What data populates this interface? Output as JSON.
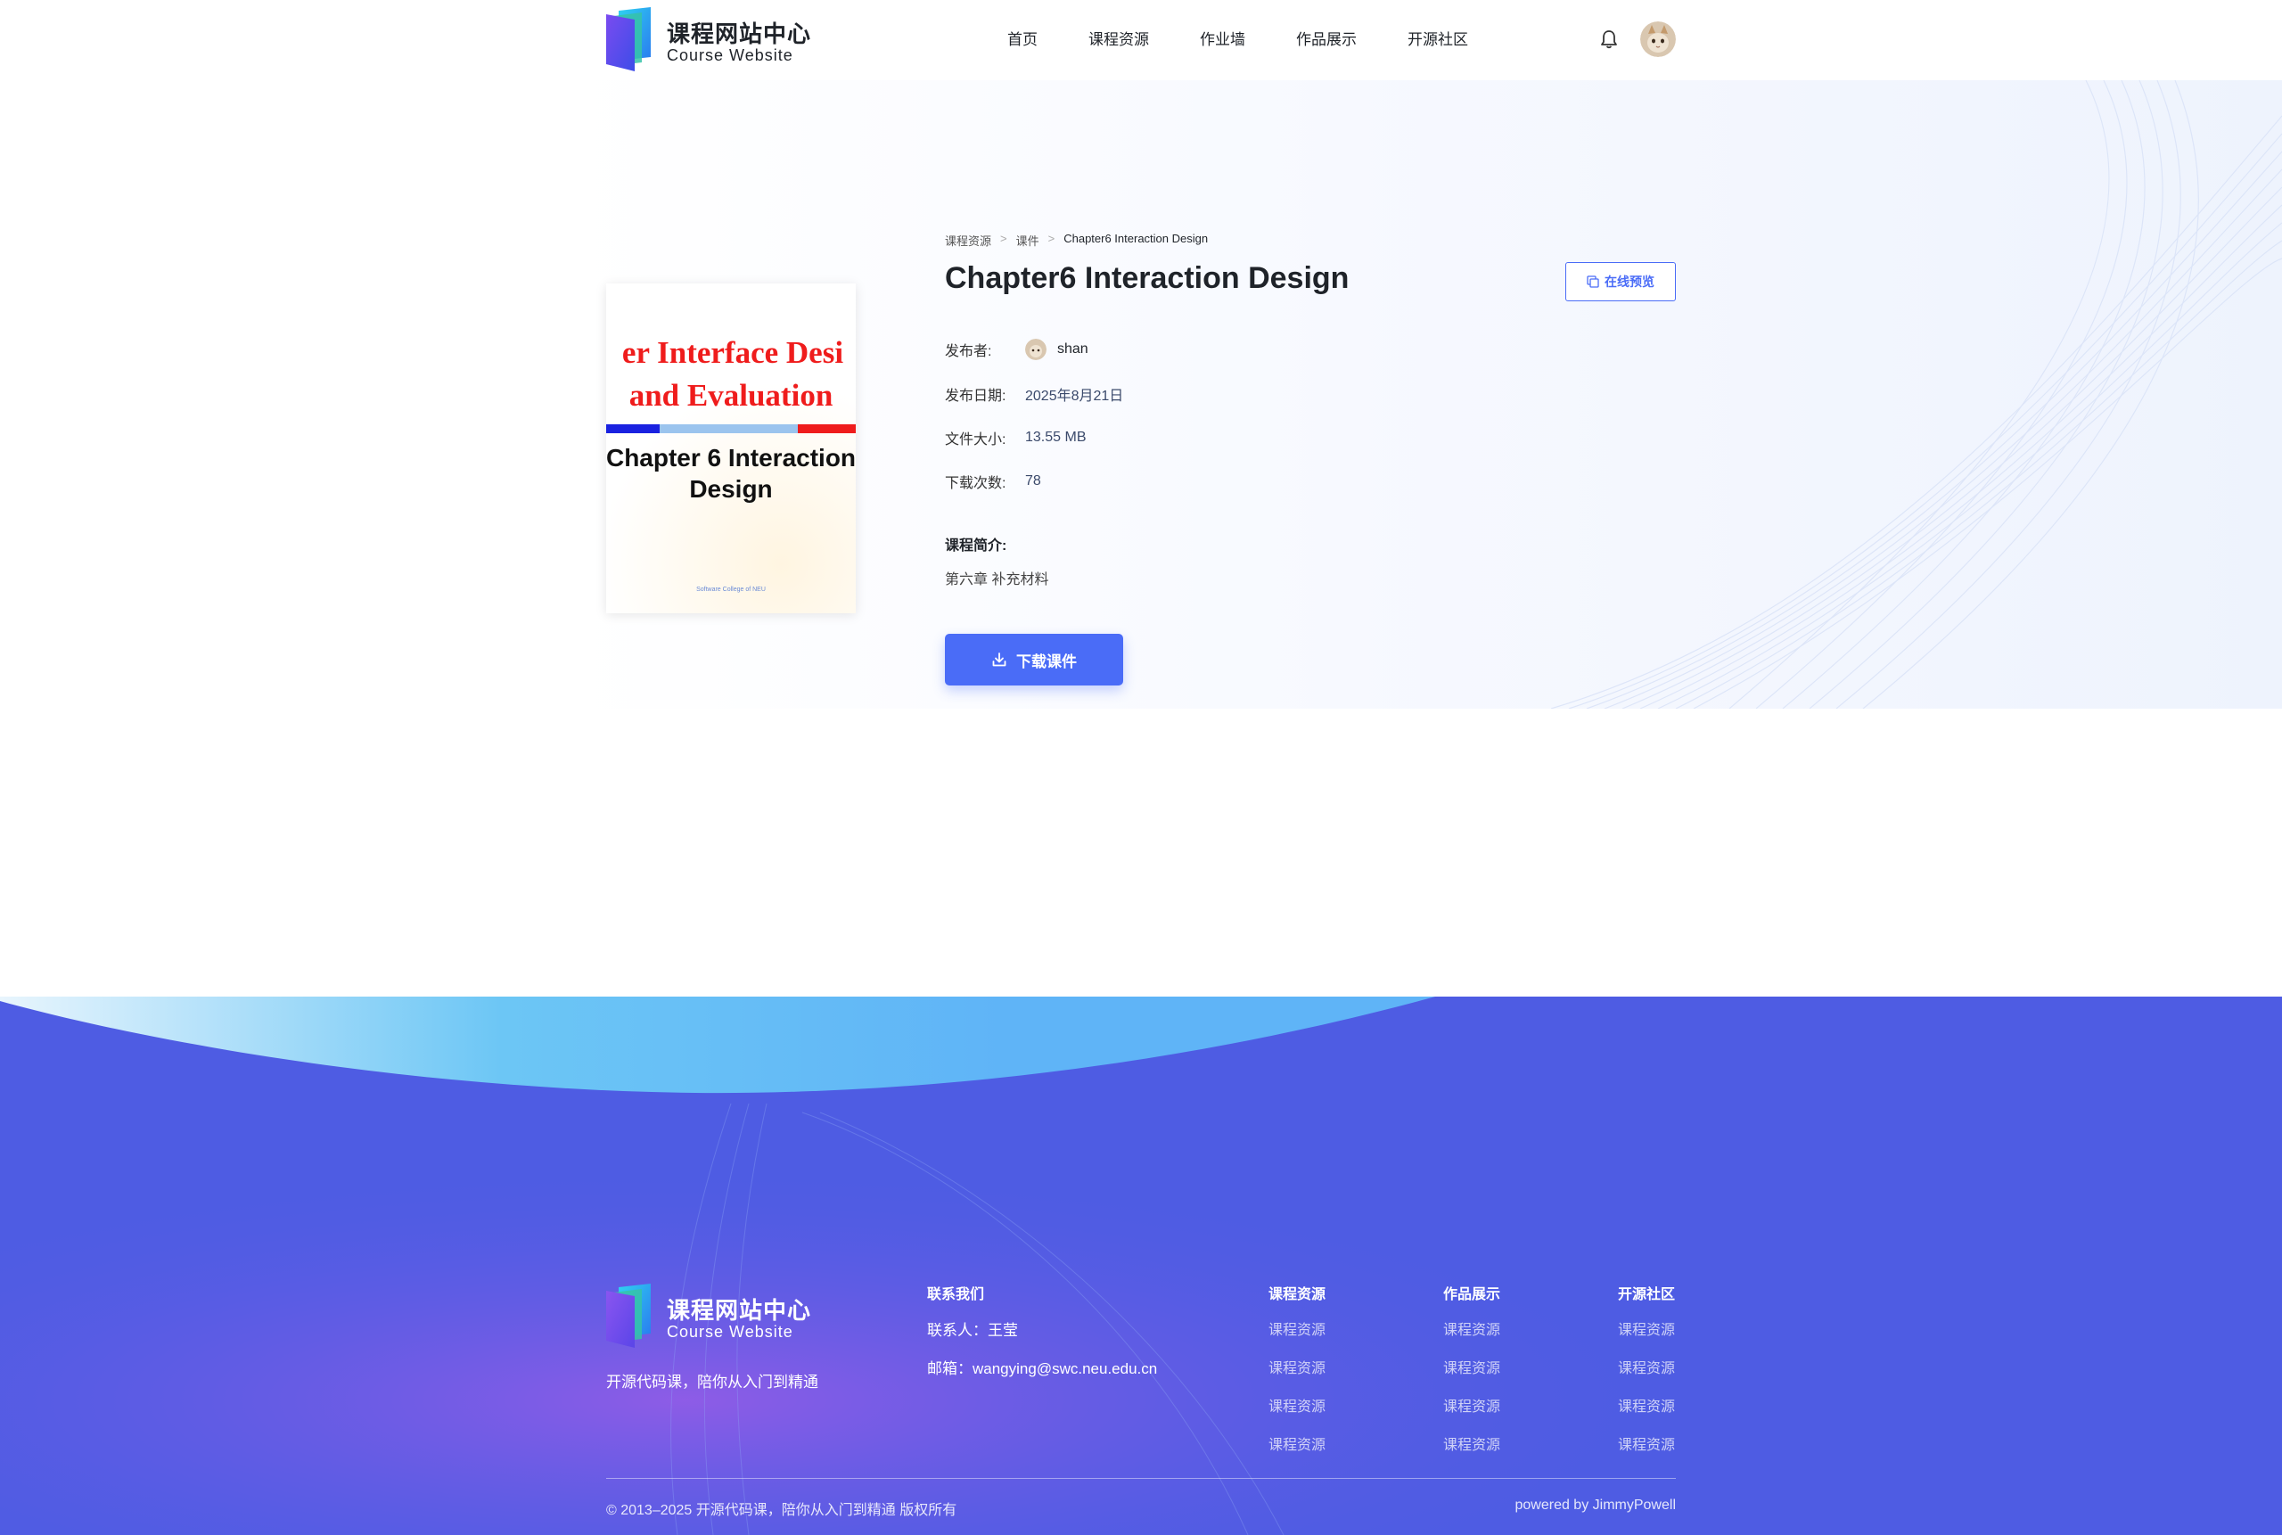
{
  "header": {
    "logo_title": "课程网站中心",
    "logo_subtitle": "Course Website",
    "nav": [
      "首页",
      "课程资源",
      "作业墙",
      "作品展示",
      "开源社区"
    ]
  },
  "detail": {
    "breadcrumb": [
      "课程资源",
      "课件",
      "Chapter6 Interaction Design"
    ],
    "title": "Chapter6 Interaction Design",
    "preview_label": "在线预览",
    "publisher_label": "发布者:",
    "publisher_name": "shan",
    "date_label": "发布日期:",
    "date_value": "2025年8月21日",
    "size_label": "文件大小:",
    "size_value": "13.55 MB",
    "downloads_label": "下载次数:",
    "downloads_value": "78",
    "intro_label": "课程简介:",
    "intro_text": "第六章 补充材料",
    "download_label": "下载课件"
  },
  "cover": {
    "line1": "er Interface Desi",
    "line2": "and Evaluation",
    "line3": "Chapter 6  Interaction",
    "line4": "Design",
    "footer": "Software College of NEU"
  },
  "footer": {
    "logo_title": "课程网站中心",
    "logo_subtitle": "Course Website",
    "slogan": "开源代码课，陪你从入门到精通",
    "contact_heading": "联系我们",
    "contact_person": "联系人：王莹",
    "contact_email": "邮箱：wangying@swc.neu.edu.cn",
    "col1_heading": "课程资源",
    "col1_links": [
      "课程资源",
      "课程资源",
      "课程资源",
      "课程资源"
    ],
    "col2_heading": "作品展示",
    "col2_links": [
      "课程资源",
      "课程资源",
      "课程资源",
      "课程资源"
    ],
    "col3_heading": "开源社区",
    "col3_links": [
      "课程资源",
      "课程资源",
      "课程资源"
    ],
    "copyright": "© 2013–2025 开源代码课，陪你从入门到精通 版权所有",
    "powered": "powered by JimmyPowell"
  },
  "colors": {
    "accent": "#4a6cf7",
    "footer_bg": "#4e5ce3",
    "cover_title": "#ef1c1c"
  },
  "icons": [
    "logo-book-icon",
    "bell-icon",
    "preview-icon",
    "download-icon"
  ]
}
